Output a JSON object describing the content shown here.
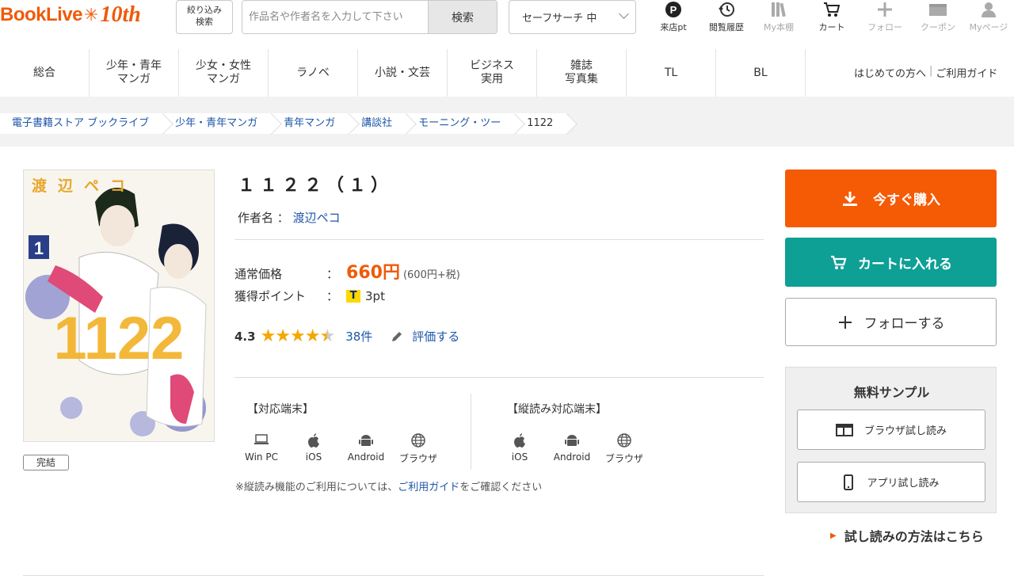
{
  "header": {
    "logo_text": "BookLive",
    "logo_10th": "10th",
    "filter_label_1": "絞り込み",
    "filter_label_2": "検索",
    "search_placeholder": "作品名や作者名を入力して下さい",
    "search_button": "検索",
    "safe_search": "セーフサーチ 中",
    "icons": [
      {
        "name": "visit-point-icon",
        "label": "来店pt"
      },
      {
        "name": "history-icon",
        "label": "閲覧履歴"
      },
      {
        "name": "bookshelf-icon",
        "label": "My本棚"
      },
      {
        "name": "cart-icon",
        "label": "カート"
      },
      {
        "name": "follow-icon",
        "label": "フォロー"
      },
      {
        "name": "coupon-icon",
        "label": "クーポン"
      },
      {
        "name": "mypage-icon",
        "label": "Myページ"
      }
    ]
  },
  "nav": {
    "items": [
      {
        "line1": "総合",
        "line2": ""
      },
      {
        "line1": "少年・青年",
        "line2": "マンガ"
      },
      {
        "line1": "少女・女性",
        "line2": "マンガ"
      },
      {
        "line1": "ラノベ",
        "line2": ""
      },
      {
        "line1": "小説・文芸",
        "line2": ""
      },
      {
        "line1": "ビジネス",
        "line2": "実用"
      },
      {
        "line1": "雑誌",
        "line2": "写真集"
      },
      {
        "line1": "TL",
        "line2": ""
      },
      {
        "line1": "BL",
        "line2": ""
      }
    ],
    "first_time": "はじめての方へ",
    "guide": "ご利用ガイド"
  },
  "breadcrumb": [
    "電子書籍ストア ブックライブ",
    "少年・青年マンガ",
    "青年マンガ",
    "講談社",
    "モーニング・ツー",
    "1122"
  ],
  "product": {
    "cover_author": "渡辺ペコ",
    "cover_volume": "1",
    "cover_title": "1122",
    "status_badge": "完結",
    "title": "１１２２（１）",
    "author_label": "作者名 ：",
    "author": "渡辺ペコ",
    "price_label": "通常価格",
    "price_colon": "：",
    "price": "660円",
    "price_detail": "(600円+税)",
    "points_label": "獲得ポイント",
    "points_colon": "：",
    "points_icon": "T",
    "points": "3pt",
    "rating": "4.3",
    "rating_value": 4.3,
    "stars_full": "★★★★",
    "stars_half": "★",
    "review_count": "38件",
    "rate_link": "評価する"
  },
  "devices": {
    "supported_head": "【対応端末】",
    "supported": [
      "Win PC",
      "iOS",
      "Android",
      "ブラウザ"
    ],
    "vertical_head": "【縦読み対応端末】",
    "vertical": [
      "iOS",
      "Android",
      "ブラウザ"
    ],
    "note_prefix": "※縦読み機能のご利用については、",
    "note_link": "ご利用ガイド",
    "note_suffix": "をご確認ください"
  },
  "actions": {
    "buy": "今すぐ購入",
    "cart": "カートに入れる",
    "follow": "フォローする",
    "sample_title": "無料サンプル",
    "browser_sample": "ブラウザ試し読み",
    "app_sample": "アプリ試し読み",
    "howto": "試し読みの方法はこちら"
  },
  "colors": {
    "brand": "#ef5a0a",
    "buy": "#f55a05",
    "cart": "#0e9f95",
    "link": "#1d56a8",
    "star": "#f5a700"
  }
}
